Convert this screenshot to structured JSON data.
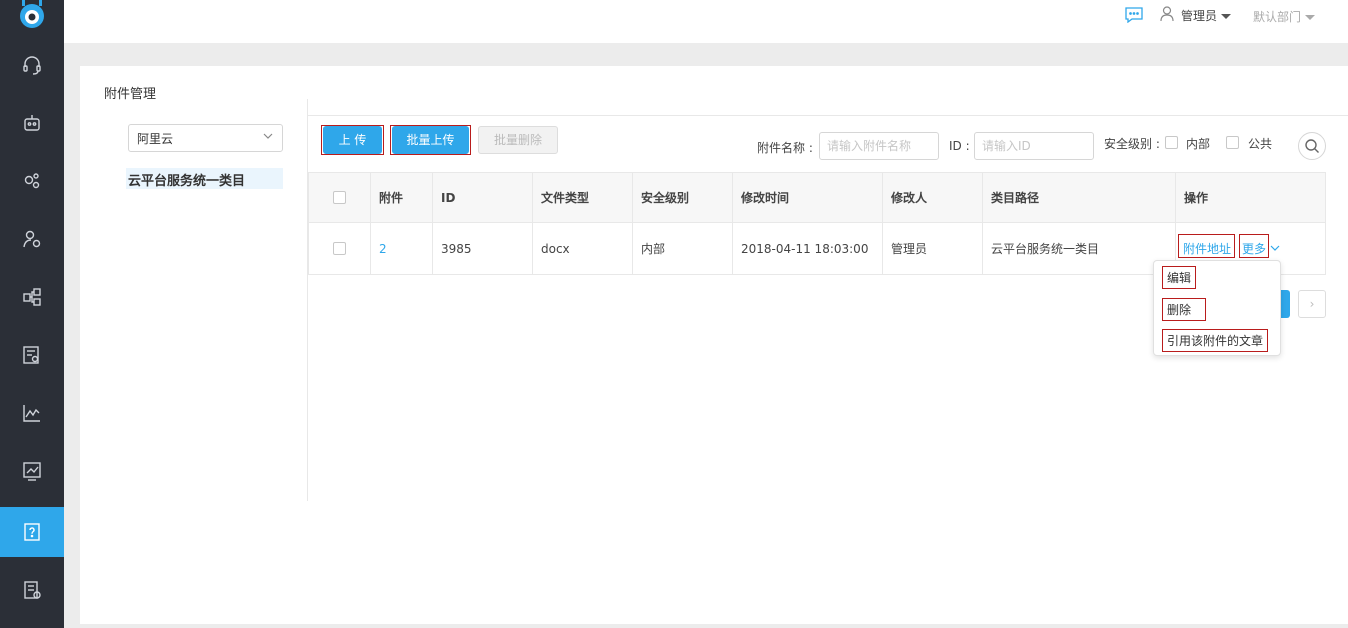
{
  "header": {
    "user_name": "管理员",
    "department": "默认部门"
  },
  "sidebar": {
    "items": [
      {
        "icon": "headset-icon"
      },
      {
        "icon": "robot-icon"
      },
      {
        "icon": "settings-group-icon"
      },
      {
        "icon": "user-settings-icon"
      },
      {
        "icon": "flow-icon"
      },
      {
        "icon": "report-search-icon"
      },
      {
        "icon": "line-chart-icon"
      },
      {
        "icon": "trend-chart-icon"
      },
      {
        "icon": "question-doc-icon",
        "active": true
      },
      {
        "icon": "doc-settings-icon"
      }
    ],
    "accent_color": "#2fa7ea",
    "bg_color": "#2b2f37"
  },
  "page": {
    "title": "附件管理"
  },
  "left_panel": {
    "category_select": "阿里云",
    "tree_item": "云平台服务统一类目"
  },
  "toolbar": {
    "upload_label": "上 传",
    "batch_upload_label": "批量上传",
    "batch_delete_label": "批量删除",
    "name_label": "附件名称 :",
    "name_placeholder": "请输入附件名称",
    "id_label": "ID :",
    "id_placeholder": "请输入ID",
    "security_label": "安全级别 :",
    "security_internal": "内部",
    "security_public": "公共"
  },
  "table": {
    "columns": [
      "附件",
      "ID",
      "文件类型",
      "安全级别",
      "修改时间",
      "修改人",
      "类目路径",
      "操作"
    ],
    "rows": [
      {
        "attachment": "2",
        "id": "3985",
        "file_type": "docx",
        "security": "内部",
        "modified_time": "2018-04-11 18:03:00",
        "modifier": "管理员",
        "category_path": "云平台服务统一类目",
        "action_address": "附件地址",
        "action_more": "更多"
      }
    ]
  },
  "more_menu": {
    "edit": "编辑",
    "delete": "删除",
    "referencing_articles": "引用该附件的文章"
  },
  "pagination": {
    "next": "›"
  }
}
